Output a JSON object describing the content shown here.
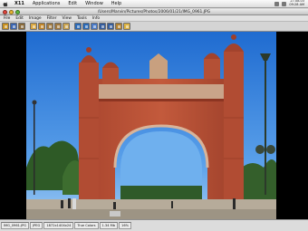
{
  "menubar": {
    "app": "X11",
    "items": [
      "Applications",
      "Edit",
      "Window",
      "Help"
    ],
    "clock_line1": "27.08.03",
    "clock_line2": "09:28 AM"
  },
  "window": {
    "title": "/Users/Marvin/Pictures/Photos/2006/01/21/IMG_0961.JPG"
  },
  "app_menu": [
    "File",
    "Edit",
    "Image",
    "Filter",
    "View",
    "Tools",
    "Info"
  ],
  "toolbar": {
    "buttons": [
      {
        "icon": "open-folder-icon",
        "color": "#c8901e"
      },
      {
        "icon": "save-icon",
        "color": "#3c66b0"
      },
      {
        "icon": "print-icon",
        "color": "#8a6a3a"
      },
      {
        "icon": "image-properties-icon",
        "color": "#d9a640"
      },
      {
        "icon": "crop-icon",
        "color": "#c0852a"
      },
      {
        "icon": "zoom-in-icon",
        "color": "#a07a40"
      },
      {
        "icon": "zoom-out-icon",
        "color": "#a07a40"
      },
      {
        "icon": "fit-window-icon",
        "color": "#c9a350"
      },
      {
        "icon": "rotate-left-icon",
        "color": "#2c6ab6"
      },
      {
        "icon": "rotate-right-icon",
        "color": "#2c6ab6"
      },
      {
        "icon": "flip-icon",
        "color": "#4a7ac6"
      },
      {
        "icon": "previous-icon",
        "color": "#365d9c"
      },
      {
        "icon": "next-icon",
        "color": "#365d9c"
      },
      {
        "icon": "slideshow-icon",
        "color": "#b08030"
      },
      {
        "icon": "help-icon",
        "color": "#dbb13f"
      }
    ]
  },
  "statusbar": {
    "filename": "IMG_0961.JPG",
    "format": "JPEG",
    "dimensions": "1872x1404x24",
    "colors": "True Colors",
    "zoom": "1.34 Mb",
    "percent": "16%"
  }
}
